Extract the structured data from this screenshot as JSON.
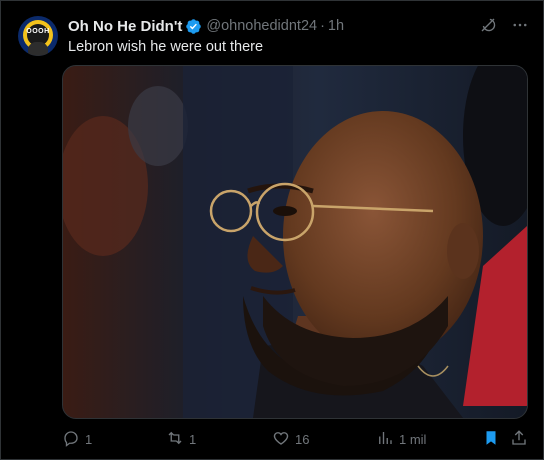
{
  "tweet": {
    "author_name": "Oh No He Didn't",
    "handle": "@ohnohedidnt24",
    "separator": "·",
    "time": "1h",
    "text": "Lebron wish he were out there",
    "avatar_text": "OOOH"
  },
  "actions": {
    "replies": "1",
    "reposts": "1",
    "likes": "16",
    "views": "1 mil"
  },
  "icons": {
    "verified": "verified-badge-icon",
    "grok": "grok-icon",
    "more": "more-icon",
    "reply": "reply-icon",
    "repost": "repost-icon",
    "like": "like-icon",
    "views": "views-icon",
    "bookmark": "bookmark-icon",
    "share": "share-icon"
  },
  "colors": {
    "background": "#000000",
    "text": "#e7e9ea",
    "muted": "#71767b",
    "accent": "#1d9bf0"
  }
}
